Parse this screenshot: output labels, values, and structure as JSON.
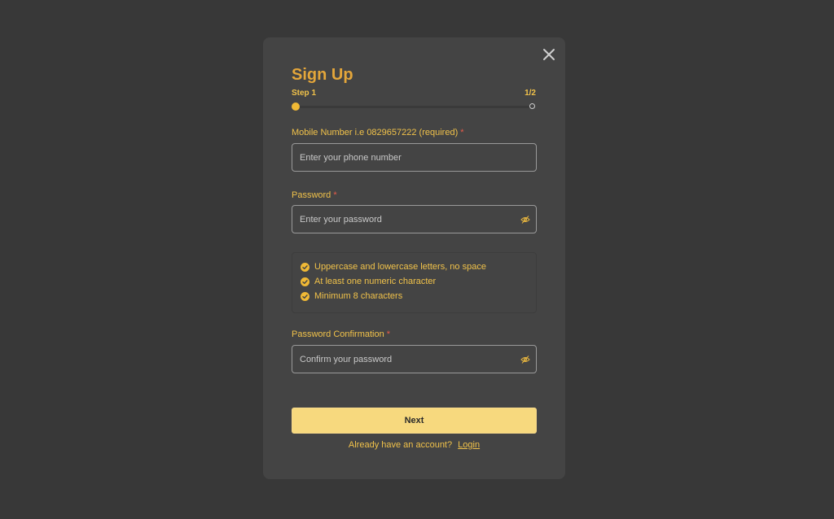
{
  "modal": {
    "title": "Sign Up",
    "step_label": "Step 1",
    "step_count": "1/2",
    "progress": 0.5,
    "close_icon": "close-icon"
  },
  "fields": {
    "mobile": {
      "label": "Mobile Number i.e 0829657222 (required)",
      "required_mark": "*",
      "placeholder": "Enter your phone number",
      "value": ""
    },
    "password": {
      "label": "Password",
      "required_mark": "*",
      "placeholder": "Enter your password",
      "value": "",
      "toggle_icon": "eye-off-icon"
    },
    "password_confirmation": {
      "label": "Password Confirmation",
      "required_mark": "*",
      "placeholder": "Confirm your password",
      "value": "",
      "toggle_icon": "eye-off-icon"
    }
  },
  "password_rules": [
    {
      "text": "Uppercase and lowercase letters, no space",
      "icon": "check-circle-icon"
    },
    {
      "text": "At least one numeric character",
      "icon": "check-circle-icon"
    },
    {
      "text": "Minimum 8 characters",
      "icon": "check-circle-icon"
    }
  ],
  "actions": {
    "next_label": "Next"
  },
  "footer": {
    "prompt": "Already have an account?",
    "login_label": "Login"
  },
  "colors": {
    "background": "#383838",
    "modal": "#444444",
    "accent": "#f1c24a",
    "title": "#e4a63a",
    "required": "#e85b4a",
    "button": "#f7d97e"
  }
}
